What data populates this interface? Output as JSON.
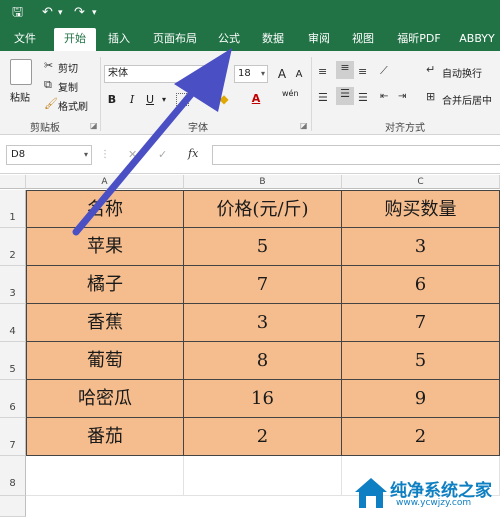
{
  "quick_access": {
    "save": "🖫",
    "undo": "↶",
    "redo": "↷",
    "more": "▾"
  },
  "tabs": [
    "文件",
    "开始",
    "插入",
    "页面布局",
    "公式",
    "数据",
    "审阅",
    "视图",
    "福昕PDF",
    "ABBYY"
  ],
  "active_tab": "开始",
  "clipboard": {
    "paste": "粘贴",
    "cut": "剪切",
    "copy": "复制",
    "format_painter": "格式刷",
    "group": "剪贴板"
  },
  "font": {
    "name": "宋体",
    "size": "18",
    "grow": "A",
    "shrink": "A",
    "bold": "B",
    "italic": "I",
    "underline": "U",
    "group": "字体",
    "wen": "wén"
  },
  "alignment": {
    "wrap_text": "自动换行",
    "merge_center": "合并后居中",
    "group": "对齐方式"
  },
  "formula_bar": {
    "name_box": "D8",
    "cancel": "✕",
    "enter": "✓",
    "fx": "fx",
    "value": ""
  },
  "columns": [
    "A",
    "B",
    "C"
  ],
  "rows": [
    "1",
    "2",
    "3",
    "4",
    "5",
    "6",
    "7",
    "8"
  ],
  "table": {
    "headers": [
      "名称",
      "价格(元/斤)",
      "购买数量"
    ],
    "rows": [
      [
        "苹果",
        "5",
        "3"
      ],
      [
        "橘子",
        "7",
        "6"
      ],
      [
        "香蕉",
        "3",
        "7"
      ],
      [
        "葡萄",
        "8",
        "5"
      ],
      [
        "哈密瓜",
        "16",
        "9"
      ],
      [
        "番茄",
        "2",
        "2"
      ]
    ]
  },
  "colors": {
    "excel_green": "#217346",
    "cell_fill": "#f5bd8e",
    "arrow": "#4b4fc4",
    "watermark": "#0e7fc2"
  },
  "watermark": {
    "text": "纯净系统之家",
    "url": "www.ycwjzy.com"
  }
}
